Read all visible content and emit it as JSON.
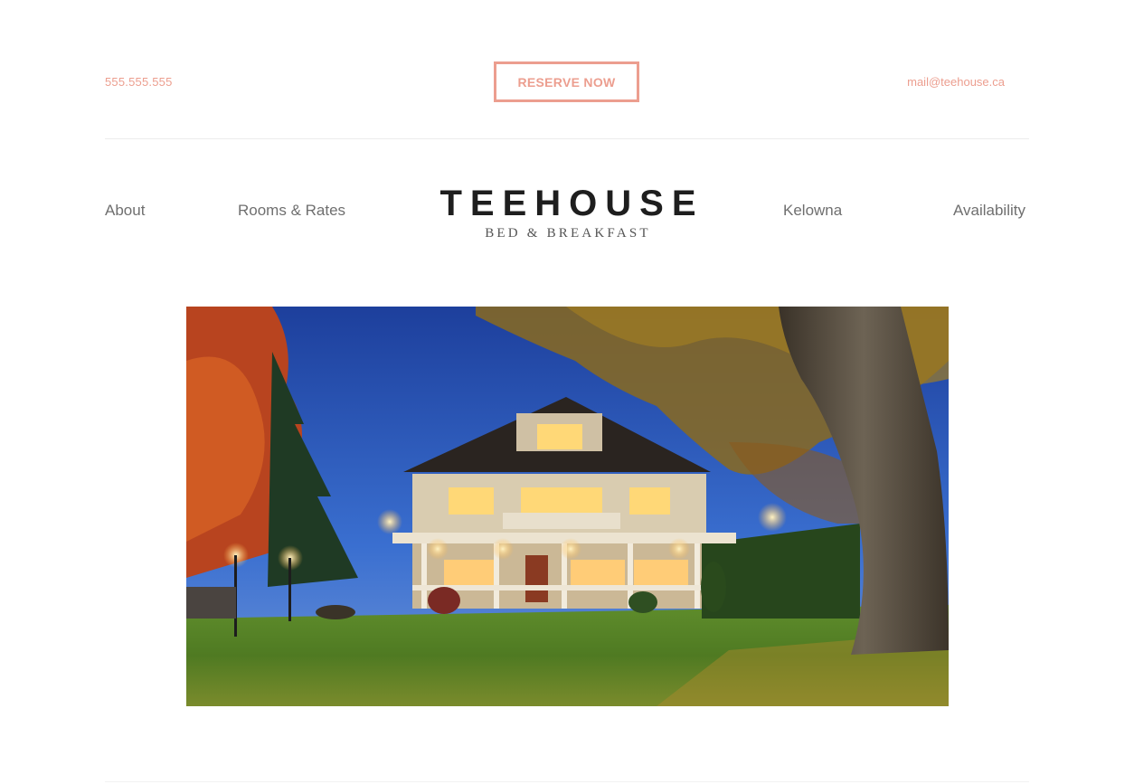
{
  "topbar": {
    "phone": "555.555.555",
    "reserve_label": "RESERVE NOW",
    "email": "mail@teehouse.ca"
  },
  "nav": {
    "about": "About",
    "rooms": "Rooms & Rates",
    "kelowna": "Kelowna",
    "availability": "Availability"
  },
  "logo": {
    "name": "TEEHOUSE",
    "tagline": "BED & BREAKFAST"
  },
  "colors": {
    "accent": "#ec9e8f",
    "nav_text": "#6f6f6f",
    "logo_text": "#1e1e1e"
  }
}
